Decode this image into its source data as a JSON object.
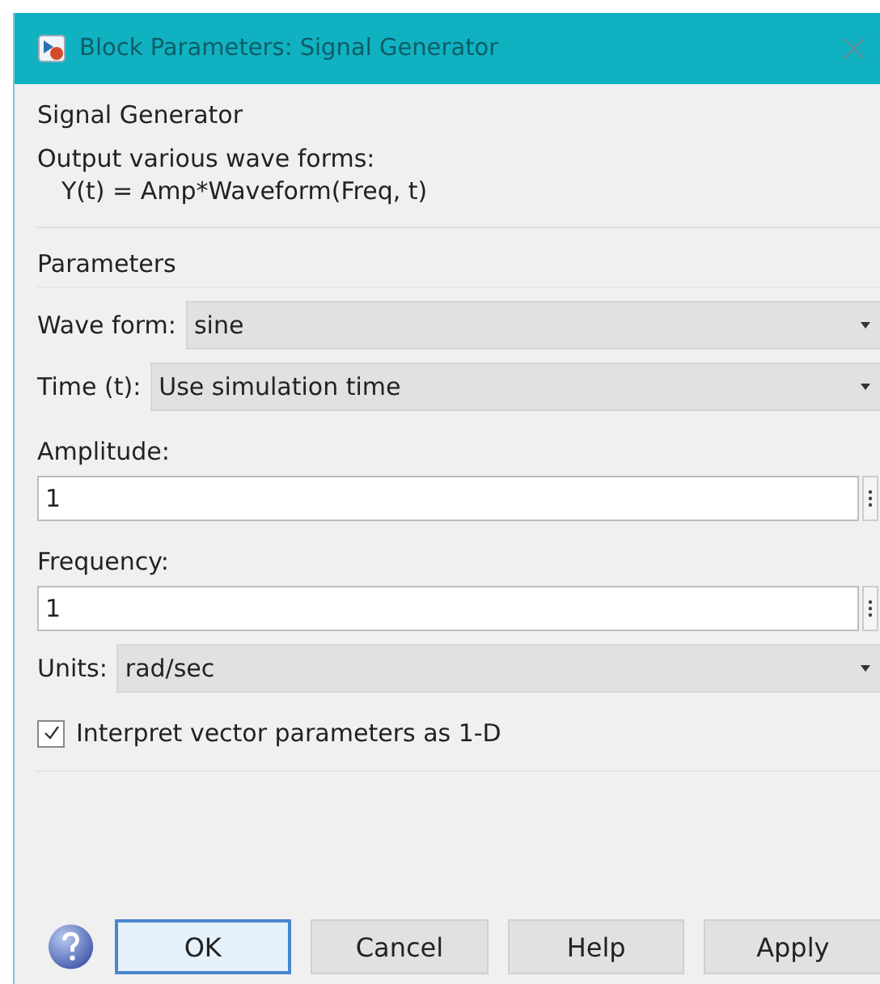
{
  "window": {
    "title": "Block Parameters: Signal Generator"
  },
  "block_name": "Signal Generator",
  "description": [
    "Output various wave forms:",
    "Y(t) = Amp*Waveform(Freq, t)"
  ],
  "section_title": "Parameters",
  "fields": [
    {
      "kind": "dropdown",
      "label": "Wave form:",
      "value": "sine"
    },
    {
      "kind": "dropdown",
      "label": "Time (t):",
      "value": "Use simulation time"
    },
    {
      "kind": "text",
      "label": "Amplitude:",
      "value": "1"
    },
    {
      "kind": "text",
      "label": "Frequency:",
      "value": "1"
    },
    {
      "kind": "dropdown",
      "label": "Units:",
      "value": "rad/sec"
    },
    {
      "kind": "checkbox",
      "label": "Interpret vector parameters as 1-D",
      "checked": true
    }
  ],
  "buttons": [
    {
      "label": "OK",
      "default": true
    },
    {
      "label": "Cancel",
      "default": false
    },
    {
      "label": "Help",
      "default": false
    },
    {
      "label": "Apply",
      "default": false
    }
  ]
}
